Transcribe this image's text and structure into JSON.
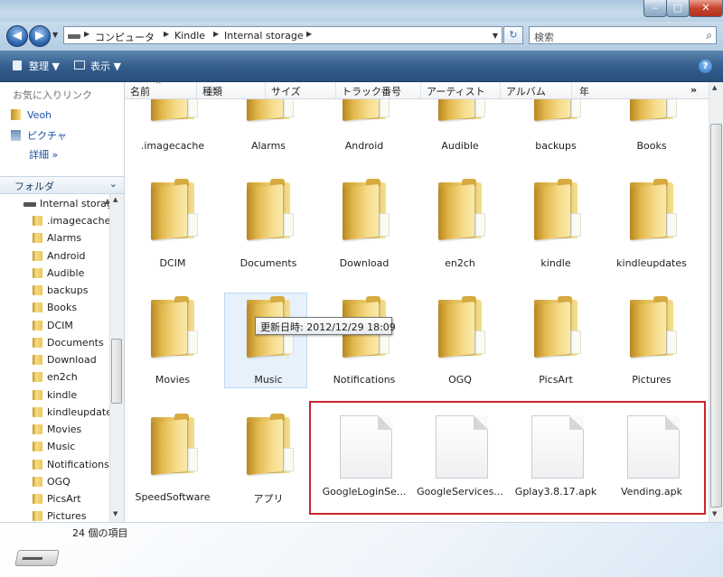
{
  "window": {
    "min_glyph": "‒",
    "max_glyph": "□",
    "close_glyph": "✕"
  },
  "nav": {
    "back_glyph": "◀",
    "forward_glyph": "▶",
    "breadcrumbs": [
      "コンピュータ",
      "Kindle",
      "Internal storage"
    ],
    "search_placeholder": "検索"
  },
  "toolbar": {
    "organize_label": "整理 ▼",
    "view_label": "表示 ▼",
    "help_glyph": "?"
  },
  "sidebar": {
    "favorites_header": "お気に入りリンク",
    "favorites": [
      "Veoh",
      "ピクチャ"
    ],
    "more_label": "詳細 »",
    "folders_label": "フォルダ",
    "tree_root": "Internal storag",
    "tree_items": [
      ".imagecache",
      "Alarms",
      "Android",
      "Audible",
      "backups",
      "Books",
      "DCIM",
      "Documents",
      "Download",
      "en2ch",
      "kindle",
      "kindleupdates",
      "Movies",
      "Music",
      "Notifications",
      "OGQ",
      "PicsArt",
      "Pictures"
    ]
  },
  "columns": [
    "名前",
    "種類",
    "サイズ",
    "トラック番号",
    "アーティスト",
    "アルバム",
    "年"
  ],
  "items": {
    "row1": [
      ".imagecache",
      "Alarms",
      "Android",
      "Audible",
      "backups",
      "Books"
    ],
    "row2": [
      "DCIM",
      "Documents",
      "Download",
      "en2ch",
      "kindle",
      "kindleupdates"
    ],
    "row3": [
      "Movies",
      "Music",
      "Notifications",
      "OGQ",
      "PicsArt",
      "Pictures"
    ],
    "row4_folders": [
      "SpeedSoftware",
      "アプリ"
    ],
    "row4_files": [
      "GoogleLoginSe...",
      "GoogleServices...",
      "Gplay3.8.17.apk",
      "Vending.apk"
    ]
  },
  "tooltip": "更新日時: 2012/12/29 18:09",
  "status": {
    "item_count": "24 個の項目"
  },
  "colors": {
    "highlight": "#c8242c",
    "toolbar": "#345e8e",
    "link": "#1a53a8"
  }
}
